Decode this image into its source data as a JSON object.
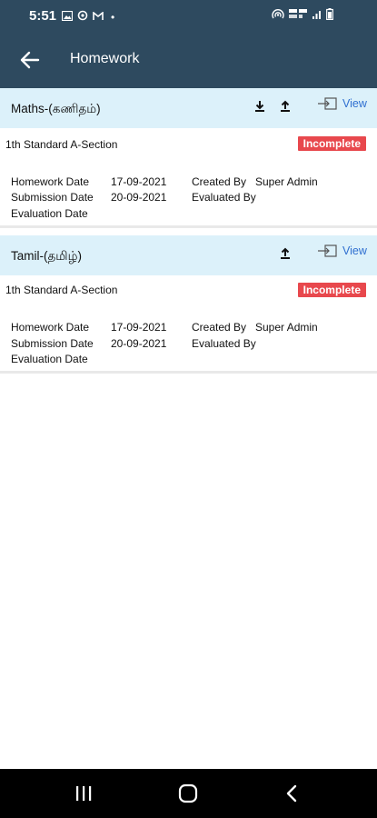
{
  "status_bar": {
    "time": "5:51",
    "dot": "•",
    "icons_left": [
      "image-icon",
      "sync-icon",
      "gmail-icon"
    ],
    "icons_right": [
      "hotspot-icon",
      "volte-lte-icon",
      "signal-icon",
      "battery-icon"
    ]
  },
  "header": {
    "title": "Homework",
    "back_icon": "arrow-left-icon"
  },
  "homework": [
    {
      "subject": "Maths-(கணிதம்)",
      "class_label": "1th Standard A-Section",
      "status": "Incomplete",
      "homework_date_label": "Homework Date",
      "homework_date": "17-09-2021",
      "submission_date_label": "Submission Date",
      "submission_date": "20-09-2021",
      "evaluation_date_label": "Evaluation Date",
      "created_by_label": "Created By",
      "created_by": "Super Admin",
      "evaluated_by_label": "Evaluated By",
      "view_label": "View"
    },
    {
      "subject": "Tamil-(தமிழ்)",
      "class_label": "1th Standard A-Section",
      "status": "Incomplete",
      "homework_date_label": "Homework Date",
      "homework_date": "17-09-2021",
      "submission_date_label": "Submission Date",
      "submission_date": "20-09-2021",
      "evaluation_date_label": "Evaluation Date",
      "created_by_label": "Created By",
      "created_by": "Super Admin",
      "evaluated_by_label": "Evaluated By",
      "view_label": "View"
    }
  ],
  "colors": {
    "header_bg": "#2e4a5f",
    "card_header_bg": "#dcf1fa",
    "badge_bg": "#e8484d",
    "view_link": "#2f6fd0"
  },
  "nav_bar": {
    "icons": [
      "recent-apps-icon",
      "home-icon",
      "back-icon"
    ]
  }
}
